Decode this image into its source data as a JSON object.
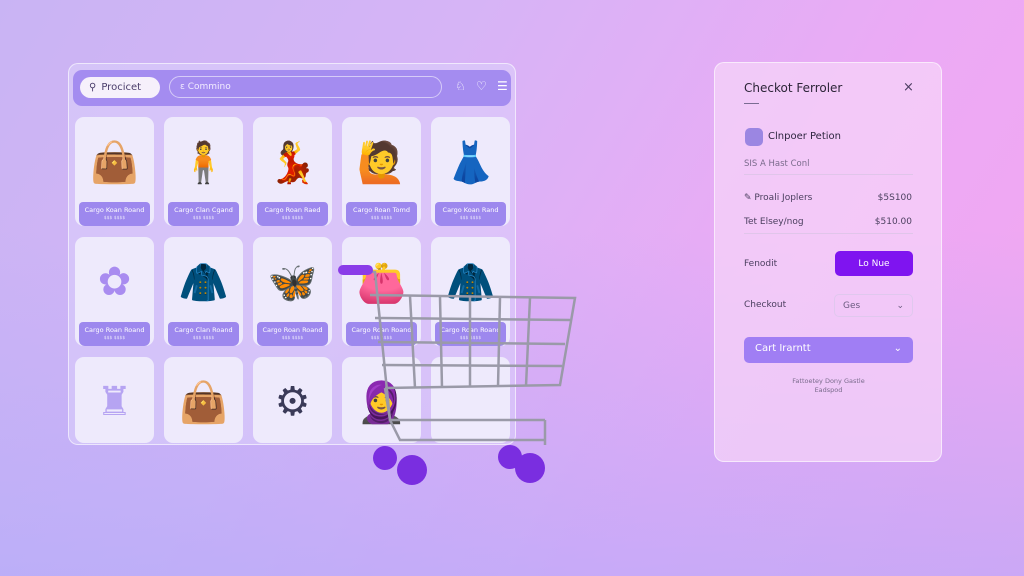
{
  "store": {
    "tab_label": "Procicet",
    "search_placeholder": "ɛ Commino",
    "header_icons": [
      "ribbon-icon",
      "heart-icon",
      "menu-icon"
    ],
    "products": [
      {
        "name": "Cargo Koan Roand",
        "price": "$$$ $$$$",
        "icon": "handbag"
      },
      {
        "name": "Cargo Clan Cgand",
        "price": "$$$ $$$$",
        "icon": "man"
      },
      {
        "name": "Cargo Roan Raed",
        "price": "$$$ $$$$",
        "icon": "girl"
      },
      {
        "name": "Cargo Roan Tomd",
        "price": "$$$ $$$$",
        "icon": "woman"
      },
      {
        "name": "Cargo Koan Rand",
        "price": "$$$ $$$$",
        "icon": "outfit"
      },
      {
        "name": "Cargo Roan Roand",
        "price": "$$$ $$$$",
        "icon": "flower"
      },
      {
        "name": "Cargo Clan Roand",
        "price": "$$$ $$$$",
        "icon": "jacket"
      },
      {
        "name": "Cargo Roan Roand",
        "price": "$$$ $$$$",
        "icon": "butterfly"
      },
      {
        "name": "Cargo Roan Roand",
        "price": "$$$ $$$$",
        "icon": "bag"
      },
      {
        "name": "Cargo Roan Roand",
        "price": "$$$ $$$$",
        "icon": "hoodie"
      },
      {
        "name": "",
        "price": "",
        "icon": "lamp"
      },
      {
        "name": "",
        "price": "",
        "icon": "tote"
      },
      {
        "name": "",
        "price": "",
        "icon": "stroller"
      },
      {
        "name": "",
        "price": "",
        "icon": "doll"
      },
      {
        "name": "",
        "price": "",
        "icon": "blank"
      }
    ]
  },
  "checkout": {
    "title": "Checkot Ferroler",
    "close": "×",
    "product_name": "Clnpoer Petion",
    "subtitle": "SIS A Hast Conl",
    "rows": [
      {
        "label": "Proali Joplers",
        "value": "$5S100"
      },
      {
        "label": "Tet Elsey/nog",
        "value": "$510.00"
      }
    ],
    "promo_label": "Fenodit",
    "promo_button": "Lo Nue",
    "checkout_label": "Checkout",
    "checkout_select": "Ges",
    "cart_button": "Cart Irarntt",
    "footer": [
      "Fattoetey Dony Gastle",
      "Eadspod"
    ]
  },
  "colors": {
    "accent": "#7f14f0",
    "header": "#a48cf0"
  }
}
